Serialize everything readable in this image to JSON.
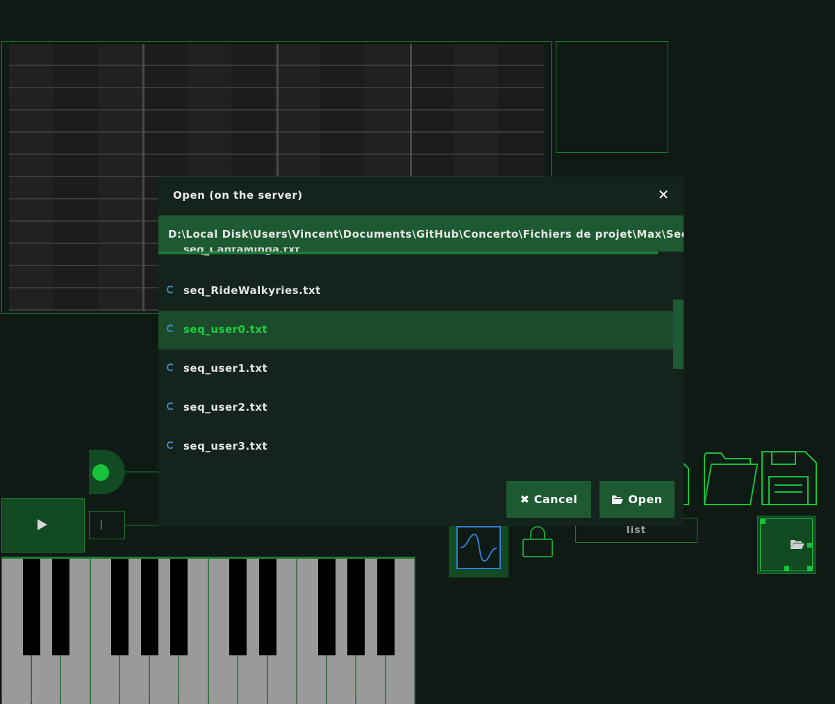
{
  "dialog": {
    "title": "Open (on the server)",
    "close_icon": "close-icon",
    "path": "D:\\Local Disk\\Users\\Vincent\\Documents\\GitHub\\Concerto\\Fichiers de projet\\Max\\Sequences",
    "partial_item": "seq_CantaMinga.txt",
    "files": [
      {
        "name": "seq_RideWalkyries.txt",
        "selected": false
      },
      {
        "name": "seq_user0.txt",
        "selected": true
      },
      {
        "name": "seq_user1.txt",
        "selected": false
      },
      {
        "name": "seq_user2.txt",
        "selected": false
      },
      {
        "name": "seq_user3.txt",
        "selected": false
      }
    ],
    "cancel_label": "Cancel",
    "open_label": "Open"
  },
  "toolbar": {
    "list_label": "list",
    "icons": [
      "waveform-icon",
      "lock-icon",
      "folder-open-icon",
      "save-icon",
      "folder-open-small-icon",
      "play-icon"
    ]
  },
  "colors": {
    "background": "#0f1a15",
    "accent": "#16c23c",
    "panel": "#1e5a31",
    "selected_text": "#19d03f"
  }
}
